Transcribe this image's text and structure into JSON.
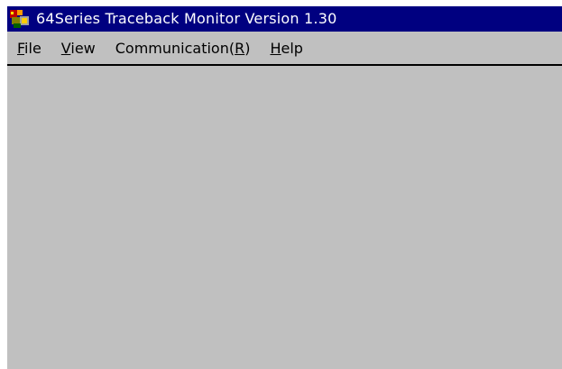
{
  "window": {
    "title": "64Series Traceback Monitor Version 1.30"
  },
  "menubar": {
    "items": [
      {
        "mnemonic": "F",
        "rest": "ile"
      },
      {
        "mnemonic": "V",
        "rest": "iew"
      },
      {
        "prefix": "Communication(",
        "mnemonic": "R",
        "rest": ")"
      },
      {
        "mnemonic": "H",
        "rest": "elp"
      }
    ]
  },
  "colors": {
    "titlebar": "#000080",
    "face": "#c0c0c0"
  },
  "icons": {
    "app": "app-icon"
  }
}
